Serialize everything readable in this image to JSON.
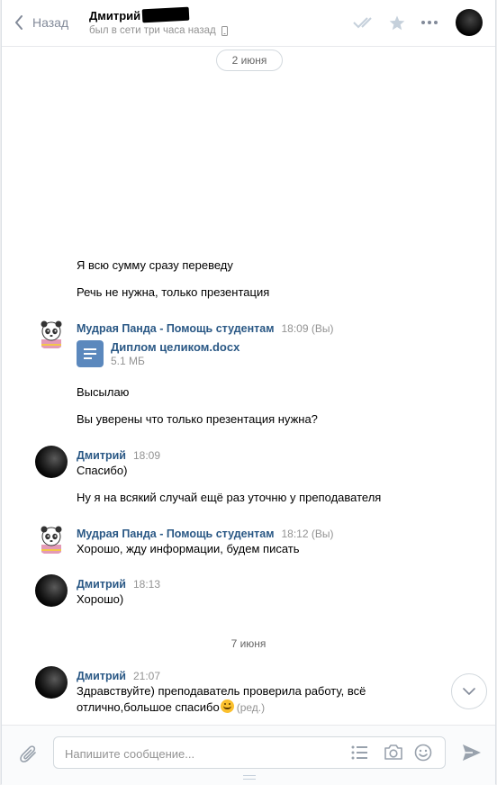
{
  "header": {
    "back_label": "Назад",
    "contact_name": "Дмитрий",
    "status": "был в сети три часа назад"
  },
  "dates": [
    "2 июня",
    "7 июня"
  ],
  "messages": {
    "m1": "Я всю сумму сразу переведу",
    "m2": "Речь не нужна, только презентация",
    "g1_author": "Мудрая Панда - Помощь студентам",
    "g1_time": "18:09 (Вы)",
    "doc_name": "Диплом целиком.docx",
    "doc_size": "5.1 МБ",
    "m3": "Высылаю",
    "m4": "Вы уверены что только презентация нужна?",
    "d1_author": "Дмитрий",
    "d1_time": "18:09",
    "m5": "Спасибо)",
    "m6": "Ну я на всякий случай ещё раз уточню у преподавателя",
    "g2_author": "Мудрая Панда - Помощь студентам",
    "g2_time": "18:12 (Вы)",
    "m7": "Хорошо, жду информации, будем писать",
    "d2_author": "Дмитрий",
    "d2_time": "18:13",
    "m8": "Хорошо)",
    "d3_author": "Дмитрий",
    "d3_time": "21:07",
    "m9_line1": "Здравствуйте) преподаватель проверила работу, всё",
    "m9_line2": "отлично,большое спасибо",
    "m9_edited": "(ред.)"
  },
  "composer": {
    "placeholder": "Напишите сообщение..."
  },
  "icons": {
    "back": "chevron-left-icon",
    "read": "double-check-icon",
    "star": "star-icon",
    "more": "ellipsis-icon",
    "mobile": "phone-icon",
    "doc": "document-icon",
    "scroll": "chevron-down-icon",
    "attach": "paperclip-icon",
    "template": "list-icon",
    "camera": "camera-icon",
    "emoji": "smile-icon",
    "send": "send-icon"
  },
  "colors": {
    "link": "#2a5885",
    "muted": "#939393",
    "doc": "#5b88bd"
  }
}
